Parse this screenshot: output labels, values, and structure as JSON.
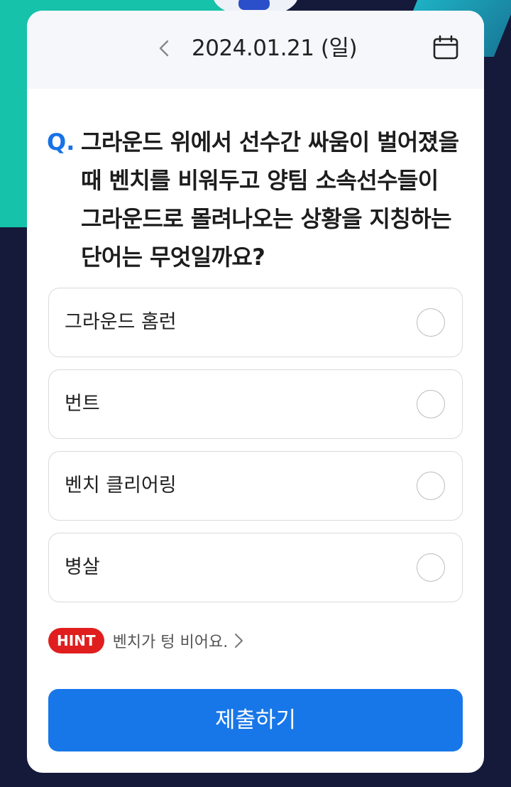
{
  "header": {
    "date": "2024.01.21 (일)"
  },
  "question": {
    "prefix": "Q.",
    "text": "그라운드 위에서 선수간 싸움이 벌어졌을 때 벤치를 비워두고 양팀 소속선수들이 그라운드로 몰려나오는 상황을 지칭하는 단어는 무엇일까요?"
  },
  "options": [
    {
      "label": "그라운드 홈런"
    },
    {
      "label": "번트"
    },
    {
      "label": "벤치 클리어링"
    },
    {
      "label": "병살"
    }
  ],
  "hint": {
    "badge": "HINT",
    "text": "벤치가 텅 비어요."
  },
  "submit": {
    "label": "제출하기"
  },
  "colors": {
    "accent": "#1877e8",
    "hint_badge": "#e01e1e",
    "background": "#15193a",
    "background_teal": "#16c2a9"
  },
  "icons": {
    "prev": "chevron-left-icon",
    "calendar": "calendar-icon",
    "hint_more": "chevron-right-icon",
    "option_state": "radio-unchecked-icon"
  }
}
